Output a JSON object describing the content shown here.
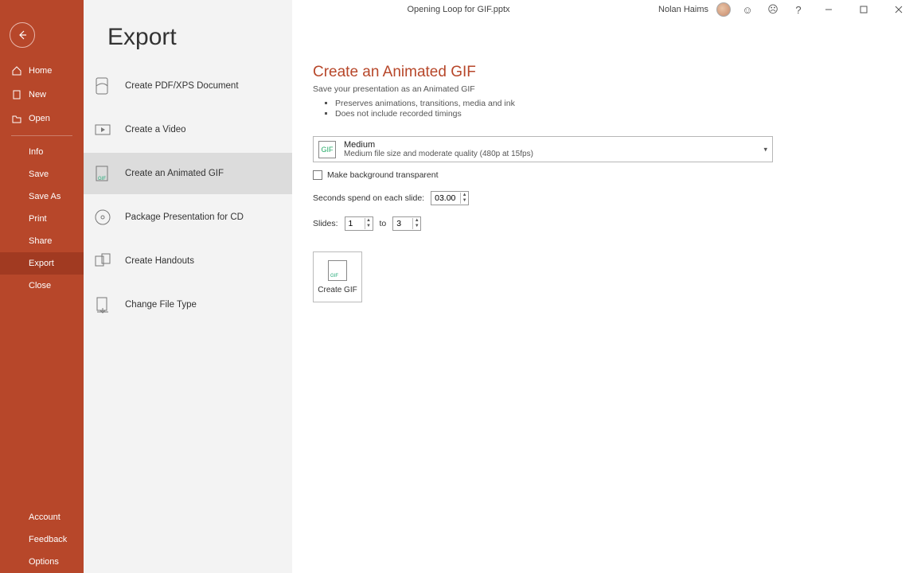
{
  "titlebar": {
    "document_title": "Opening Loop for GIF.pptx",
    "user_name": "Nolan Haims"
  },
  "sidebar": {
    "home": "Home",
    "new": "New",
    "open": "Open",
    "info": "Info",
    "save": "Save",
    "save_as": "Save As",
    "print": "Print",
    "share": "Share",
    "export": "Export",
    "close": "Close",
    "account": "Account",
    "feedback": "Feedback",
    "options": "Options"
  },
  "mid": {
    "heading": "Export",
    "items": {
      "pdf": "Create PDF/XPS Document",
      "video": "Create a Video",
      "gif": "Create an Animated GIF",
      "cd": "Package Presentation for CD",
      "handouts": "Create Handouts",
      "filetype": "Change File Type"
    }
  },
  "panel": {
    "title": "Create an Animated GIF",
    "subtitle": "Save your presentation as an Animated GIF",
    "bullet1": "Preserves animations, transitions, media and ink",
    "bullet2": "Does not include recorded timings",
    "quality": {
      "name": "Medium",
      "desc": "Medium file size and moderate quality (480p at 15fps)"
    },
    "transparent_label": "Make background transparent",
    "seconds_label": "Seconds spend on each slide:",
    "seconds_value": "03.00",
    "slides_label": "Slides:",
    "slides_from": "1",
    "slides_to_label": "to",
    "slides_to": "3",
    "create_label": "Create GIF"
  }
}
